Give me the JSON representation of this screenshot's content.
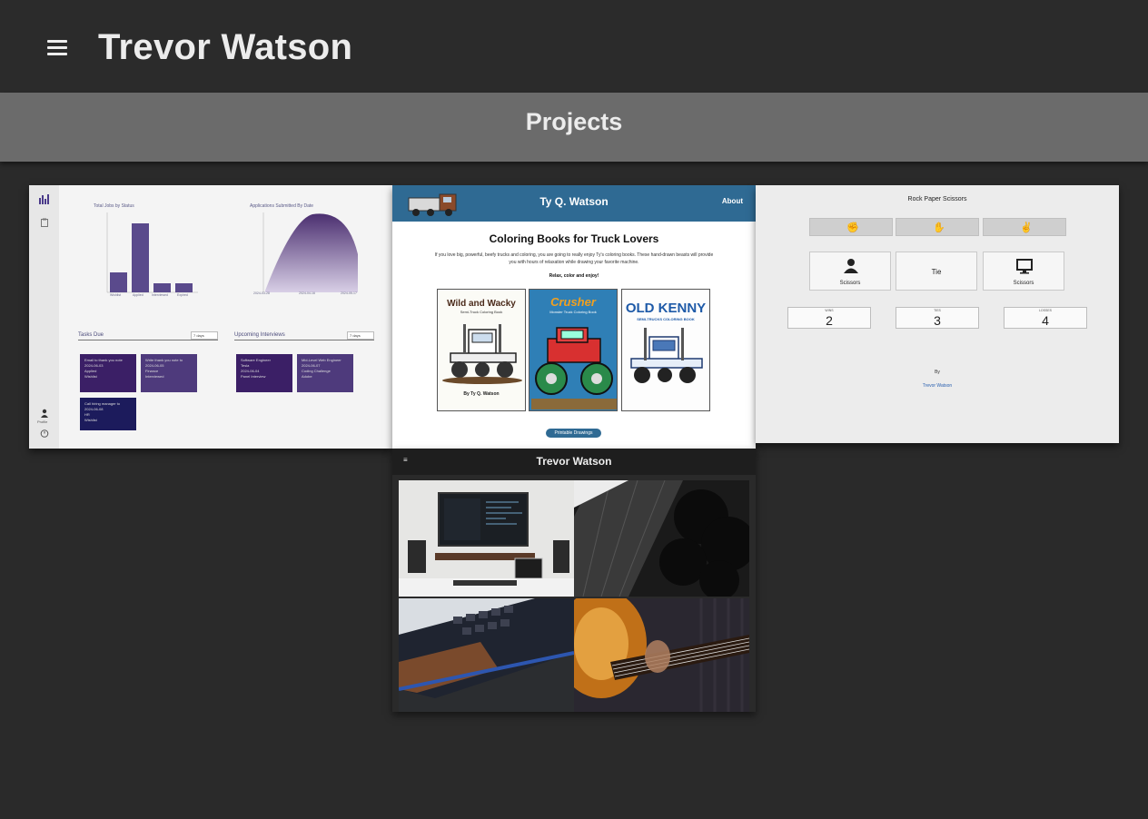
{
  "header": {
    "menu_icon": "hamburger-icon",
    "title": "Trevor Watson"
  },
  "section": {
    "title": "Projects"
  },
  "cards": {
    "job_tracker": {
      "chart1_title": "Total Jobs by Status",
      "chart1_categories": [
        "Wishlist",
        "Applied",
        "Interviewed",
        "Expired"
      ],
      "chart2_title": "Applications Submitted By Date",
      "chart2_dates": [
        "2024-03-28",
        "2024-04-16",
        "2024-05-17"
      ],
      "tasks_title": "Tasks Due",
      "interviews_title": "Upcoming Interviews",
      "select_label": "7 days",
      "tasks": [
        {
          "l1": "Email to thank you note",
          "l2": "2024-06-03",
          "l3": "Applied",
          "l4": "Wishlist"
        },
        {
          "l1": "Write thank you note to",
          "l2": "2024-06-05",
          "l3": "Finance",
          "l4": "Interviewed"
        },
        {
          "l1": "Call hiring manager to",
          "l2": "2024-06-08",
          "l3": "HR",
          "l4": "Wishlist"
        }
      ],
      "interviews": [
        {
          "l1": "Software Engineer",
          "l2": "Tesla",
          "l3": "2024-06-04",
          "l4": "Panel Interview"
        },
        {
          "l1": "Mid-Level Web Engineer",
          "l2": "2024-06-07",
          "l3": "Coding Challenge",
          "l4": "Adobe"
        }
      ],
      "profile_label": "Profile"
    },
    "coloring": {
      "brand": "Ty Q. Watson",
      "about": "About",
      "heading": "Coloring Books for Truck Lovers",
      "body": "If you love big, powerful, beefy trucks and coloring, you are going to really enjoy Ty's coloring books. These hand-drawn beasts will provide you with hours of relaxation while drawing your favorite machine.",
      "relax": "Relax, color and enjoy!",
      "books": [
        {
          "title": "Wild and Wacky",
          "subtitle": "Semi-Truck Coloring Book",
          "author": "By Ty Q. Watson"
        },
        {
          "title": "Crusher",
          "subtitle": "Monster Truck Coloring Book",
          "author": ""
        },
        {
          "title": "OLD KENNY",
          "subtitle": "SEMI-TRUCKS COLORING BOOK",
          "author": ""
        }
      ],
      "button": "Printable Drawings"
    },
    "rps": {
      "title": "Rock Paper Scissors",
      "choices": [
        "rock",
        "paper",
        "scissors"
      ],
      "player_label": "Scissors",
      "result_label": "Tie",
      "computer_label": "Scissors",
      "wins_label": "WINS",
      "wins": "2",
      "ties_label": "TIES",
      "ties": "3",
      "losses_label": "LOSSES",
      "losses": "4",
      "by": "By",
      "author": "Trevor Watson"
    },
    "portfolio": {
      "name": "Trevor Watson"
    }
  }
}
